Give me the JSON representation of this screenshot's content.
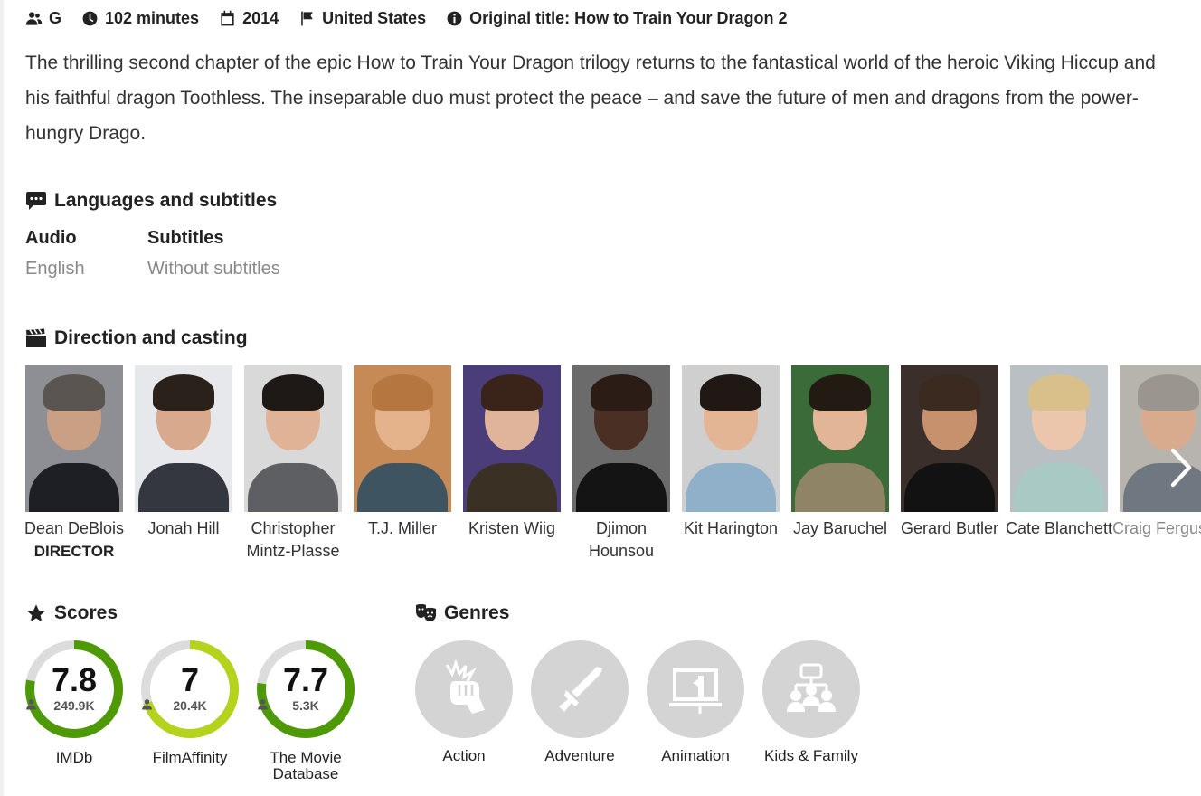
{
  "meta": {
    "rating": "G",
    "duration": "102 minutes",
    "year": "2014",
    "country": "United States",
    "original_title": "Original title: How to Train Your Dragon 2"
  },
  "synopsis": "The thrilling second chapter of the epic How to Train Your Dragon trilogy returns to the fantastical world of the heroic Viking Hiccup and his faithful dragon Toothless. The inseparable duo must protect the peace – and save the future of men and dragons from the power-hungry Drago.",
  "languages": {
    "title": "Languages and subtitles",
    "audio_label": "Audio",
    "audio_value": "English",
    "subtitles_label": "Subtitles",
    "subtitles_value": "Without subtitles"
  },
  "cast": {
    "title": "Direction and casting",
    "members": [
      {
        "name": "Dean DeBlois",
        "role": "DIRECTOR"
      },
      {
        "name": "Jonah Hill",
        "role": ""
      },
      {
        "name": "Christopher Mintz-Plasse",
        "role": ""
      },
      {
        "name": "T.J. Miller",
        "role": ""
      },
      {
        "name": "Kristen Wiig",
        "role": ""
      },
      {
        "name": "Djimon Hounsou",
        "role": ""
      },
      {
        "name": "Kit Harington",
        "role": ""
      },
      {
        "name": "Jay Baruchel",
        "role": ""
      },
      {
        "name": "Gerard Butler",
        "role": ""
      },
      {
        "name": "Cate Blanchett",
        "role": ""
      },
      {
        "name": "Craig Ferguson",
        "role": ""
      }
    ]
  },
  "scores": {
    "title": "Scores",
    "items": [
      {
        "value": "7.8",
        "votes": "249.9K",
        "source": "IMDb",
        "fraction": 0.78,
        "color": "#4e9a06"
      },
      {
        "value": "7",
        "votes": "20.4K",
        "source": "FilmAffinity",
        "fraction": 0.7,
        "color": "#b5d31c"
      },
      {
        "value": "7.7",
        "votes": "5.3K",
        "source": "The Movie Database",
        "fraction": 0.77,
        "color": "#4e9a06"
      }
    ]
  },
  "genres": {
    "title": "Genres",
    "items": [
      {
        "name": "Action",
        "icon": "fist-icon"
      },
      {
        "name": "Adventure",
        "icon": "sword-icon"
      },
      {
        "name": "Animation",
        "icon": "animation-board-icon"
      },
      {
        "name": "Kids & Family",
        "icon": "family-icon"
      }
    ]
  }
}
